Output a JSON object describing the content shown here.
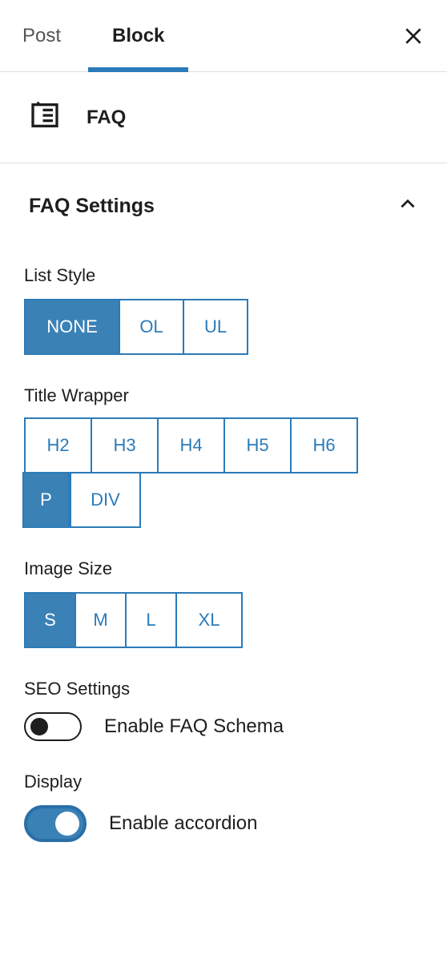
{
  "tabs": {
    "post": "Post",
    "block": "Block",
    "active": "block"
  },
  "block": {
    "name": "FAQ"
  },
  "section": {
    "title": "FAQ Settings",
    "expanded": true
  },
  "fields": {
    "list_style": {
      "label": "List Style",
      "options": [
        "NONE",
        "OL",
        "UL"
      ],
      "selected": "NONE"
    },
    "title_wrapper": {
      "label": "Title Wrapper",
      "options": [
        "H2",
        "H3",
        "H4",
        "H5",
        "H6",
        "P",
        "DIV"
      ],
      "selected": "P"
    },
    "image_size": {
      "label": "Image Size",
      "options": [
        "S",
        "M",
        "L",
        "XL"
      ],
      "selected": "S"
    },
    "seo": {
      "label": "SEO Settings",
      "toggle_label": "Enable FAQ Schema",
      "enabled": false
    },
    "display": {
      "label": "Display",
      "toggle_label": "Enable accordion",
      "enabled": true
    }
  }
}
